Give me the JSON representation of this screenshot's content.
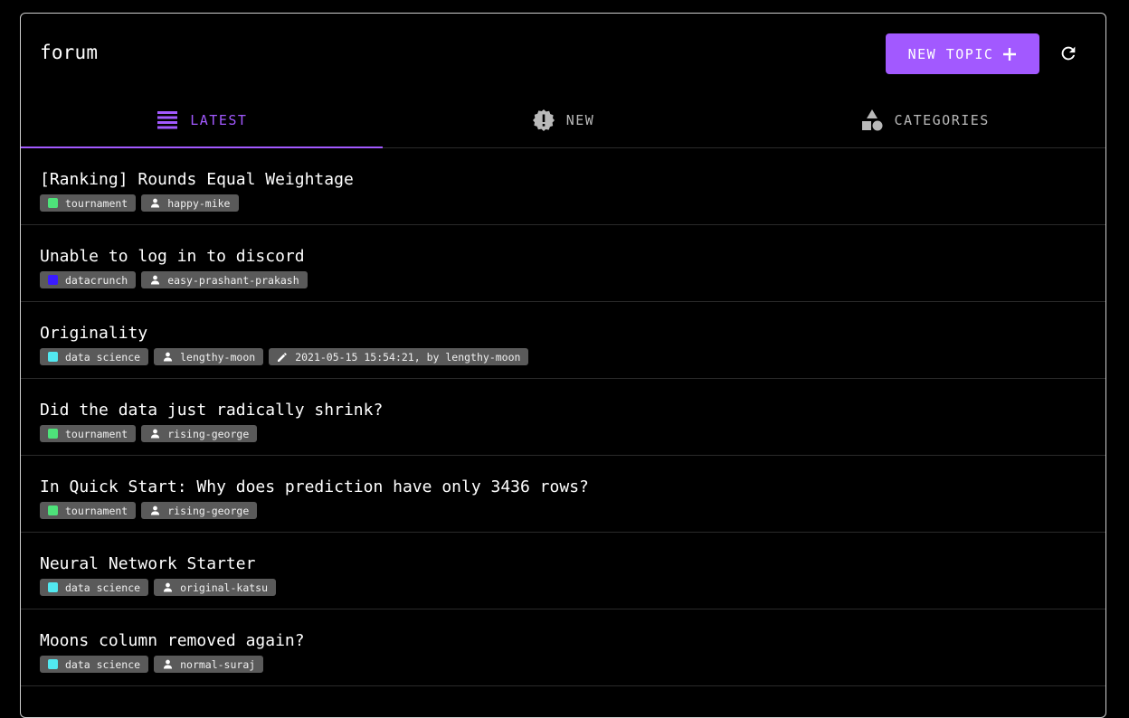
{
  "header": {
    "title": "forum",
    "new_topic_label": "NEW TOPIC",
    "accent_color": "#a259ff"
  },
  "tabs": [
    {
      "label": "LATEST",
      "icon": "list-icon",
      "active": true
    },
    {
      "label": "NEW",
      "icon": "new-badge-icon",
      "active": false
    },
    {
      "label": "CATEGORIES",
      "icon": "categories-shapes-icon",
      "active": false
    }
  ],
  "category_colors": {
    "tournament": "#4ee27a",
    "datacrunch": "#3a1bff",
    "data science": "#52e8f0"
  },
  "topics": [
    {
      "title": "[Ranking] Rounds Equal Weightage",
      "category": "tournament",
      "author": "happy-mike",
      "edited": ""
    },
    {
      "title": "Unable to log in to discord",
      "category": "datacrunch",
      "author": "easy-prashant-prakash",
      "edited": ""
    },
    {
      "title": "Originality",
      "category": "data science",
      "author": "lengthy-moon",
      "edited": "2021-05-15 15:54:21, by lengthy-moon"
    },
    {
      "title": "Did the data just radically shrink?",
      "category": "tournament",
      "author": "rising-george",
      "edited": ""
    },
    {
      "title": "In Quick Start: Why does prediction have only 3436 rows?",
      "category": "tournament",
      "author": "rising-george",
      "edited": ""
    },
    {
      "title": "Neural Network Starter",
      "category": "data science",
      "author": "original-katsu",
      "edited": ""
    },
    {
      "title": "Moons column removed again?",
      "category": "data science",
      "author": "normal-suraj",
      "edited": ""
    }
  ]
}
